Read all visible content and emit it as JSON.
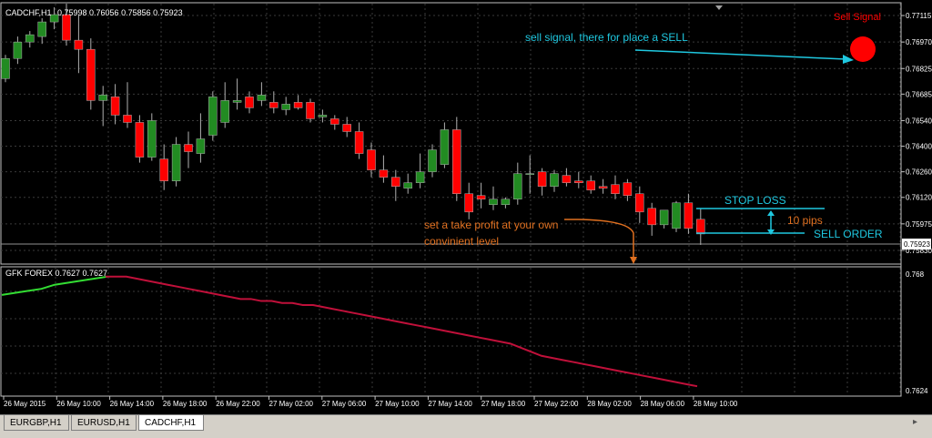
{
  "main_chart": {
    "header": "CADCHF,H1",
    "ohlc": "0.75998 0.76056 0.75856 0.75923",
    "price_labels": [
      "0.77115",
      "0.76970",
      "0.76825",
      "0.76685",
      "0.76540",
      "0.76400",
      "0.76260",
      "0.76120",
      "0.75975",
      "0.75830"
    ],
    "current_price": "0.75923",
    "annotations": {
      "sell_signal": "Sell Signal",
      "sell_note": "sell signal, there for place a SELL",
      "stop_loss": "STOP LOSS",
      "pips": "10 pips",
      "sell_order": "SELL ORDER",
      "take_profit_line1": "set a take profit at your own",
      "take_profit_line2": "convinient level"
    }
  },
  "indicator": {
    "header": "GFK FOREX 0.7627 0.7627",
    "price_labels": [
      "0.768",
      "0.7624"
    ]
  },
  "time_labels": [
    "26 May 2015",
    "26 May 10:00",
    "26 May 14:00",
    "26 May 18:00",
    "26 May 22:00",
    "27 May 02:00",
    "27 May 06:00",
    "27 May 10:00",
    "27 May 14:00",
    "27 May 18:00",
    "27 May 22:00",
    "28 May 02:00",
    "28 May 06:00",
    "28 May 10:00"
  ],
  "tabs": [
    {
      "label": "EURGBP,H1",
      "active": false
    },
    {
      "label": "EURUSD,H1",
      "active": false
    },
    {
      "label": "CADCHF,H1",
      "active": true
    }
  ],
  "colors": {
    "bull": "#228b22",
    "bear": "#ff0000",
    "grid": "#3a3a3a",
    "annotation_cyan": "#1fc8e0",
    "annotation_orange": "#e07020",
    "signal_red": "#ff0000",
    "indicator_green": "#33dd33",
    "indicator_red": "#c0103a"
  },
  "chart_data": {
    "type": "candlestick",
    "symbol": "CADCHF,H1",
    "ylim": [
      0.7576,
      0.7718
    ],
    "candles": [
      {
        "o": 0.7677,
        "h": 0.769,
        "c": 0.7688,
        "l": 0.7675
      },
      {
        "o": 0.7688,
        "h": 0.77,
        "c": 0.7697,
        "l": 0.7685
      },
      {
        "o": 0.7697,
        "h": 0.7703,
        "c": 0.7701,
        "l": 0.7694
      },
      {
        "o": 0.77,
        "h": 0.771,
        "c": 0.7708,
        "l": 0.7696
      },
      {
        "o": 0.7708,
        "h": 0.7716,
        "c": 0.7712,
        "l": 0.7704
      },
      {
        "o": 0.7712,
        "h": 0.7718,
        "c": 0.7698,
        "l": 0.7695
      },
      {
        "o": 0.7698,
        "h": 0.7712,
        "c": 0.7693,
        "l": 0.768
      },
      {
        "o": 0.7693,
        "h": 0.7699,
        "c": 0.7665,
        "l": 0.766
      },
      {
        "o": 0.7665,
        "h": 0.7673,
        "c": 0.7668,
        "l": 0.7651
      },
      {
        "o": 0.7667,
        "h": 0.7674,
        "c": 0.7657,
        "l": 0.7652
      },
      {
        "o": 0.7657,
        "h": 0.7675,
        "c": 0.7653,
        "l": 0.765
      },
      {
        "o": 0.7653,
        "h": 0.7657,
        "c": 0.7634,
        "l": 0.7631
      },
      {
        "o": 0.7634,
        "h": 0.7658,
        "c": 0.7654,
        "l": 0.7632
      },
      {
        "o": 0.7633,
        "h": 0.7641,
        "c": 0.7621,
        "l": 0.7616
      },
      {
        "o": 0.7621,
        "h": 0.7645,
        "c": 0.7641,
        "l": 0.7618
      },
      {
        "o": 0.7641,
        "h": 0.7648,
        "c": 0.7637,
        "l": 0.7628
      },
      {
        "o": 0.7636,
        "h": 0.7658,
        "c": 0.7644,
        "l": 0.7631
      },
      {
        "o": 0.7646,
        "h": 0.767,
        "c": 0.7667,
        "l": 0.7643
      },
      {
        "o": 0.7653,
        "h": 0.7675,
        "c": 0.7665,
        "l": 0.765
      },
      {
        "o": 0.7664,
        "h": 0.7677,
        "c": 0.7665,
        "l": 0.766
      },
      {
        "o": 0.7667,
        "h": 0.767,
        "c": 0.7661,
        "l": 0.7658
      },
      {
        "o": 0.7665,
        "h": 0.7675,
        "c": 0.7668,
        "l": 0.7662
      },
      {
        "o": 0.7664,
        "h": 0.767,
        "c": 0.7661,
        "l": 0.7658
      },
      {
        "o": 0.766,
        "h": 0.7667,
        "c": 0.7663,
        "l": 0.7657
      },
      {
        "o": 0.7664,
        "h": 0.7668,
        "c": 0.7661,
        "l": 0.766
      },
      {
        "o": 0.7664,
        "h": 0.7666,
        "c": 0.7655,
        "l": 0.7653
      },
      {
        "o": 0.7656,
        "h": 0.766,
        "c": 0.7657,
        "l": 0.7653
      },
      {
        "o": 0.7655,
        "h": 0.7657,
        "c": 0.7652,
        "l": 0.7649
      },
      {
        "o": 0.7652,
        "h": 0.7656,
        "c": 0.7648,
        "l": 0.7645
      },
      {
        "o": 0.7648,
        "h": 0.7653,
        "c": 0.7636,
        "l": 0.7633
      },
      {
        "o": 0.7638,
        "h": 0.7642,
        "c": 0.7627,
        "l": 0.7623
      },
      {
        "o": 0.7627,
        "h": 0.7635,
        "c": 0.7623,
        "l": 0.762
      },
      {
        "o": 0.7623,
        "h": 0.7627,
        "c": 0.7618,
        "l": 0.761
      },
      {
        "o": 0.7617,
        "h": 0.7625,
        "c": 0.762,
        "l": 0.7614
      },
      {
        "o": 0.762,
        "h": 0.7636,
        "c": 0.7626,
        "l": 0.7617
      },
      {
        "o": 0.7626,
        "h": 0.7641,
        "c": 0.7638,
        "l": 0.7623
      },
      {
        "o": 0.763,
        "h": 0.7653,
        "c": 0.7649,
        "l": 0.7628
      },
      {
        "o": 0.7649,
        "h": 0.7656,
        "c": 0.7614,
        "l": 0.761
      },
      {
        "o": 0.7614,
        "h": 0.762,
        "c": 0.7604,
        "l": 0.76
      },
      {
        "o": 0.7613,
        "h": 0.762,
        "c": 0.7611,
        "l": 0.7606
      },
      {
        "o": 0.7608,
        "h": 0.7618,
        "c": 0.7611,
        "l": 0.7605
      },
      {
        "o": 0.7608,
        "h": 0.7612,
        "c": 0.7611,
        "l": 0.7606
      },
      {
        "o": 0.7611,
        "h": 0.7631,
        "c": 0.7625,
        "l": 0.7608
      },
      {
        "o": 0.7625,
        "h": 0.7635,
        "c": 0.7625,
        "l": 0.7614
      },
      {
        "o": 0.7626,
        "h": 0.7628,
        "c": 0.7618,
        "l": 0.7613
      },
      {
        "o": 0.7618,
        "h": 0.7627,
        "c": 0.7625,
        "l": 0.7615
      },
      {
        "o": 0.7624,
        "h": 0.7628,
        "c": 0.762,
        "l": 0.7618
      },
      {
        "o": 0.7621,
        "h": 0.7626,
        "c": 0.762,
        "l": 0.7617
      },
      {
        "o": 0.7621,
        "h": 0.7624,
        "c": 0.7616,
        "l": 0.7614
      },
      {
        "o": 0.7618,
        "h": 0.7622,
        "c": 0.7617,
        "l": 0.7614
      },
      {
        "o": 0.7619,
        "h": 0.7624,
        "c": 0.7614,
        "l": 0.7611
      },
      {
        "o": 0.762,
        "h": 0.7622,
        "c": 0.7613,
        "l": 0.761
      },
      {
        "o": 0.7614,
        "h": 0.7618,
        "c": 0.7604,
        "l": 0.7598
      },
      {
        "o": 0.7606,
        "h": 0.7609,
        "c": 0.7597,
        "l": 0.7591
      },
      {
        "o": 0.7597,
        "h": 0.7605,
        "c": 0.7605,
        "l": 0.7595
      },
      {
        "o": 0.7595,
        "h": 0.761,
        "c": 0.7609,
        "l": 0.7593
      },
      {
        "o": 0.7609,
        "h": 0.7614,
        "c": 0.7595,
        "l": 0.7592
      },
      {
        "o": 0.76,
        "h": 0.7606,
        "c": 0.7592,
        "l": 0.7586
      }
    ],
    "indicator": {
      "name": "GFK FOREX",
      "ylim": [
        0.76215,
        0.76825
      ],
      "green": [
        0.767,
        0.7671,
        0.7672,
        0.7673,
        0.7675,
        0.7676,
        0.7677,
        0.7678,
        0.7679
      ],
      "red": [
        0.7679,
        0.7679,
        0.7679,
        0.7678,
        0.7677,
        0.7676,
        0.7675,
        0.7674,
        0.7673,
        0.7672,
        0.7671,
        0.767,
        0.7669,
        0.7668,
        0.7668,
        0.7667,
        0.7667,
        0.7666,
        0.7666,
        0.7665,
        0.7665,
        0.7664,
        0.7663,
        0.7662,
        0.7661,
        0.766,
        0.7659,
        0.7658,
        0.7657,
        0.7656,
        0.7655,
        0.7654,
        0.7653,
        0.7652,
        0.7651,
        0.765,
        0.7649,
        0.7648,
        0.7647,
        0.7646,
        0.7644,
        0.7642,
        0.764,
        0.7639,
        0.7638,
        0.7637,
        0.7636,
        0.7635,
        0.7634,
        0.7633,
        0.7632,
        0.7631,
        0.763,
        0.7629,
        0.7628,
        0.7627,
        0.7626,
        0.7625
      ]
    }
  }
}
